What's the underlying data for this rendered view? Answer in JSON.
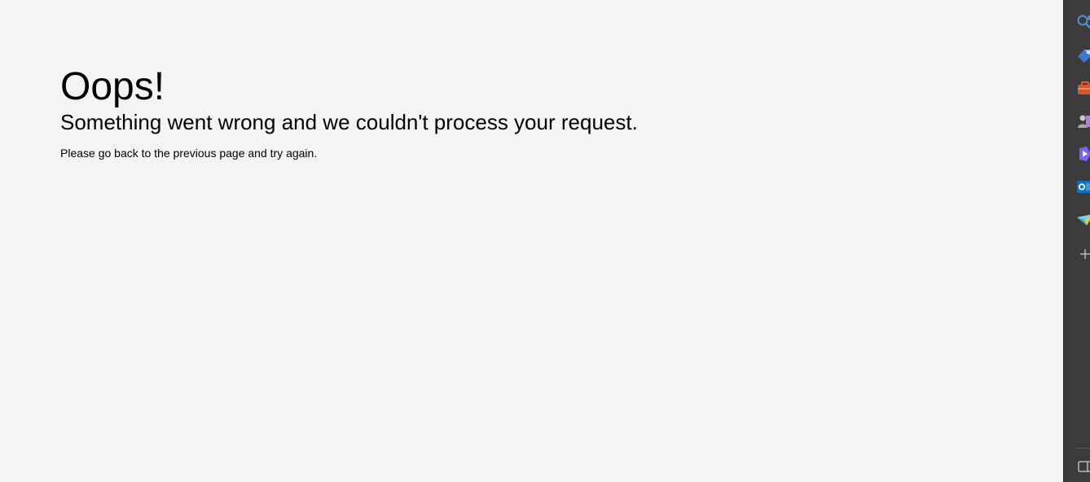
{
  "error": {
    "heading": "Oops!",
    "subheading": "Something went wrong and we couldn't process your request.",
    "instruction": "Please go back to the previous page and try again."
  },
  "sidebar": {
    "items": [
      {
        "icon": "search-icon",
        "color": "#4a90e2"
      },
      {
        "icon": "shopping-tag-icon",
        "color": "#3a7bd5"
      },
      {
        "icon": "tools-briefcase-icon",
        "color": "#d9532c"
      },
      {
        "icon": "games-icon",
        "color": "#b07cf0"
      },
      {
        "icon": "copilot-icon",
        "color": "#7b61ff"
      },
      {
        "icon": "outlook-icon",
        "color": "#0a72c6"
      },
      {
        "icon": "drop-send-icon",
        "color": "#2eb7a8"
      },
      {
        "icon": "add-icon",
        "color": "#d0d0d0"
      }
    ],
    "bottom": {
      "icon": "sidebar-toggle-icon",
      "color": "#d0d0d0"
    }
  },
  "colors": {
    "page_background": "#f4f4f4",
    "sidebar_background": "#3b3b3b",
    "text": "#000000"
  }
}
